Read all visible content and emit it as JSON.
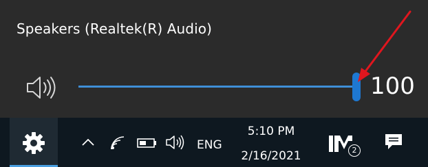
{
  "flyout": {
    "device_name": "Speakers (Realtek(R) Audio)",
    "volume_value": "100",
    "volume_level_percent": 100,
    "speaker_icon": "speaker-volume-icon",
    "accent_color": "#1e78d2"
  },
  "annotation": {
    "arrow_color": "#e0161e",
    "icon": "red-arrow-icon"
  },
  "taskbar": {
    "settings_icon": "gear-icon",
    "tray_icons": [
      "chevron-up-icon",
      "wifi-icon",
      "battery-icon",
      "speaker-icon"
    ],
    "language": "ENG",
    "time": "5:10 PM",
    "date": "2/16/2021",
    "app_icon": "media-app-icon",
    "app_badge": "2",
    "notification_icon": "action-center-icon"
  }
}
